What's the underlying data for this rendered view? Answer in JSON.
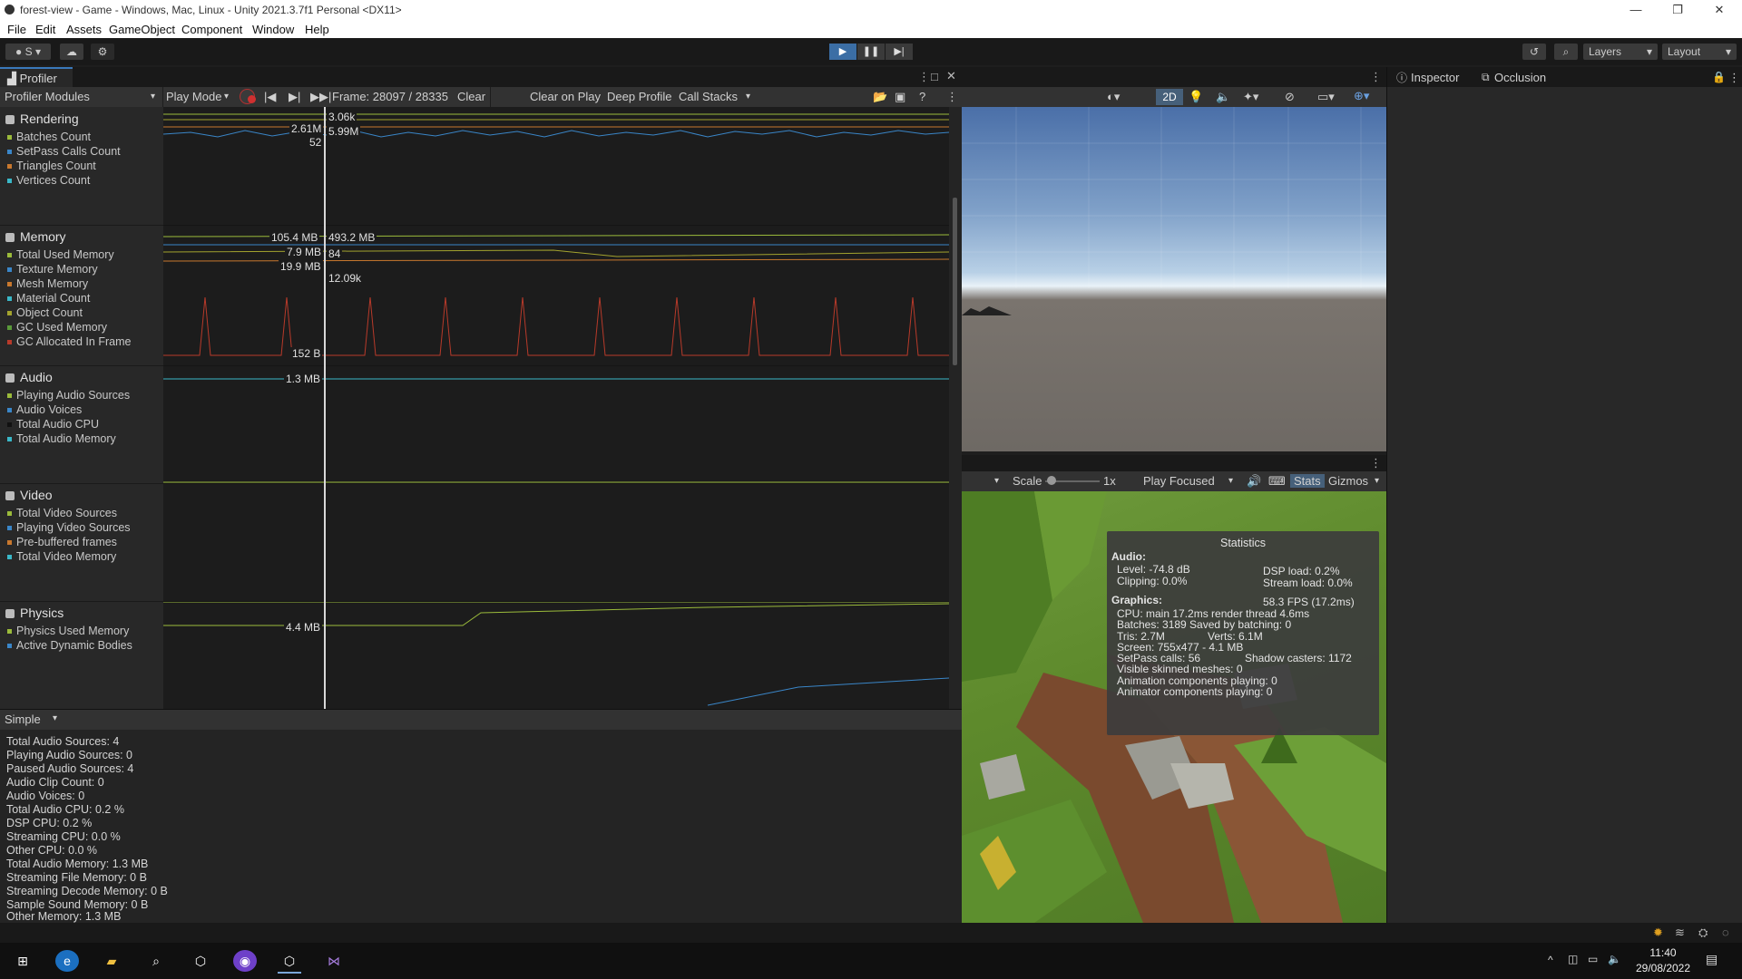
{
  "window": {
    "title": "forest-view - Game - Windows, Mac, Linux - Unity 2021.3.7f1 Personal <DX11>",
    "controls": [
      "—",
      "❐",
      "✕"
    ]
  },
  "menu": [
    "File",
    "Edit",
    "Assets",
    "GameObject",
    "Component",
    "Window",
    "Help"
  ],
  "toolbar": {
    "account": "S",
    "layers": "Layers",
    "layout": "Layout"
  },
  "profiler": {
    "tab": "Profiler",
    "modules_dropdown": "Profiler Modules",
    "play_mode": "Play Mode",
    "frame": "Frame: 28097 / 28335",
    "clear": "Clear",
    "clear_on_play": "Clear on Play",
    "deep_profile": "Deep Profile",
    "call_stacks": "Call Stacks",
    "modules": [
      {
        "title": "Rendering",
        "items": [
          {
            "label": "Batches Count",
            "color": "#9bbb3b"
          },
          {
            "label": "SetPass Calls Count",
            "color": "#3a86c8"
          },
          {
            "label": "Triangles Count",
            "color": "#c8782e"
          },
          {
            "label": "Vertices Count",
            "color": "#3ab8c8"
          }
        ]
      },
      {
        "title": "Memory",
        "items": [
          {
            "label": "Total Used Memory",
            "color": "#9bbb3b"
          },
          {
            "label": "Texture Memory",
            "color": "#3a86c8"
          },
          {
            "label": "Mesh Memory",
            "color": "#c8782e"
          },
          {
            "label": "Material Count",
            "color": "#3ab8c8"
          },
          {
            "label": "Object Count",
            "color": "#a3a32e"
          },
          {
            "label": "GC Used Memory",
            "color": "#5a9a3a"
          },
          {
            "label": "GC Allocated In Frame",
            "color": "#b83a2a"
          }
        ]
      },
      {
        "title": "Audio",
        "items": [
          {
            "label": "Playing Audio Sources",
            "color": "#9bbb3b"
          },
          {
            "label": "Audio Voices",
            "color": "#3a86c8"
          },
          {
            "label": "Total Audio CPU",
            "color": "#111111"
          },
          {
            "label": "Total Audio Memory",
            "color": "#3ab8c8"
          }
        ]
      },
      {
        "title": "Video",
        "items": [
          {
            "label": "Total Video Sources",
            "color": "#9bbb3b"
          },
          {
            "label": "Playing Video Sources",
            "color": "#3a86c8"
          },
          {
            "label": "Pre-buffered frames",
            "color": "#c8782e"
          },
          {
            "label": "Total Video Memory",
            "color": "#3ab8c8"
          }
        ]
      },
      {
        "title": "Physics",
        "items": [
          {
            "label": "Physics Used Memory",
            "color": "#9bbb3b"
          },
          {
            "label": "Active Dynamic Bodies",
            "color": "#3a86c8"
          }
        ]
      }
    ],
    "graph_labels": {
      "r1": "3.06k",
      "r2": "2.61M",
      "r3": "5.99M",
      "r4": "52",
      "m1": "105.4 MB",
      "m2": "493.2 MB",
      "m3": "7.9 MB",
      "m4": "84",
      "m5": "19.9 MB",
      "m6": "12.09k",
      "m7": "152 B",
      "a1": "1.3 MB",
      "p1": "4.4 MB"
    },
    "details_mode": "Simple",
    "details": [
      "Total Audio Sources: 4",
      "Playing Audio Sources: 0",
      "Paused Audio Sources: 4",
      "Audio Clip Count: 0",
      "Audio Voices: 0",
      "Total Audio CPU: 0.2 %",
      "DSP CPU: 0.2 %",
      "Streaming CPU: 0.0 %",
      "Other CPU: 0.0 %",
      "Total Audio Memory: 1.3 MB",
      "Streaming File Memory: 0 B",
      "Streaming Decode Memory: 0 B",
      "Sample Sound Memory: 0 B",
      "Other Memory: 1.3 MB"
    ]
  },
  "scene": {
    "btn_2d": "2D"
  },
  "game": {
    "scale_label": "Scale",
    "scale_value": "1x",
    "play_focused": "Play Focused",
    "stats": "Stats",
    "gizmos": "Gizmos",
    "statistics": {
      "title": "Statistics",
      "audio_header": "Audio:",
      "level": "Level: -74.8 dB",
      "dsp_load": "DSP load: 0.2%",
      "clipping": "Clipping: 0.0%",
      "stream_load": "Stream load: 0.0%",
      "graphics_header": "Graphics:",
      "fps": "58.3 FPS (17.2ms)",
      "cpu": "CPU: main 17.2ms  render thread 4.6ms",
      "batches": "Batches: 3189   Saved by batching: 0",
      "tris": "Tris: 2.7M",
      "verts": "Verts: 6.1M",
      "screen": "Screen: 755x477 - 4.1 MB",
      "setpass": "SetPass calls: 56",
      "shadow": "Shadow casters: 1172",
      "skinned": "Visible skinned meshes: 0",
      "anim": "Animation components playing: 0",
      "animator": "Animator components playing: 0"
    }
  },
  "inspector": {
    "tab_inspector": "Inspector",
    "tab_occlusion": "Occlusion"
  },
  "taskbar": {
    "time": "11:40",
    "date": "29/08/2022"
  }
}
